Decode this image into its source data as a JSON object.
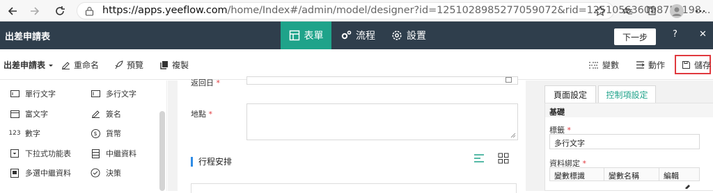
{
  "browser": {
    "url_host": "https://apps.yeeflow.com",
    "url_rest": "/home/Index#/admin/model/designer?id=1251028985277059072&rid=125105636098756198..."
  },
  "header": {
    "app_title": "出差申請表",
    "tabs": [
      {
        "label": "表單",
        "active": true
      },
      {
        "label": "流程",
        "active": false
      },
      {
        "label": "設置",
        "active": false
      }
    ],
    "next_label": "下一步",
    "help_label": "?",
    "close_label": "✕"
  },
  "toolbar": {
    "form_select": "出差申請表",
    "rename": "重命名",
    "preview": "預覽",
    "copy": "複製",
    "variables": "變數",
    "actions": "動作",
    "save": "儲存"
  },
  "components": [
    {
      "label": "單行文字",
      "icon": "single-line-icon"
    },
    {
      "label": "多行文字",
      "icon": "multi-line-icon"
    },
    {
      "label": "富文字",
      "icon": "rich-text-icon"
    },
    {
      "label": "簽名",
      "icon": "signature-icon"
    },
    {
      "label": "數字",
      "icon": "number-icon",
      "glyph": "123"
    },
    {
      "label": "貨幣",
      "icon": "currency-icon",
      "glyph": "$"
    },
    {
      "label": "下拉式功能表",
      "icon": "dropdown-icon"
    },
    {
      "label": "中繼資料",
      "icon": "metadata-icon"
    },
    {
      "label": "多選中繼資料",
      "icon": "multi-metadata-icon"
    },
    {
      "label": "決策",
      "icon": "decision-icon"
    }
  ],
  "form": {
    "partial_label": "返回日",
    "address_label": "地點",
    "section_title": "行程安排"
  },
  "properties": {
    "tab_page": "頁面設定",
    "tab_control": "控制項設定",
    "section": "基礎",
    "label_field": "標籤",
    "label_value": "多行文字",
    "binding_field": "資料綁定",
    "col_var_id": "變數標識",
    "col_var_name": "變數名稱",
    "col_edit": "編輯"
  },
  "colors": {
    "header_bg": "#2f3e4c",
    "active_tab": "#1fa38a",
    "required": "#e0393e",
    "accent": "#2f8ce5"
  }
}
